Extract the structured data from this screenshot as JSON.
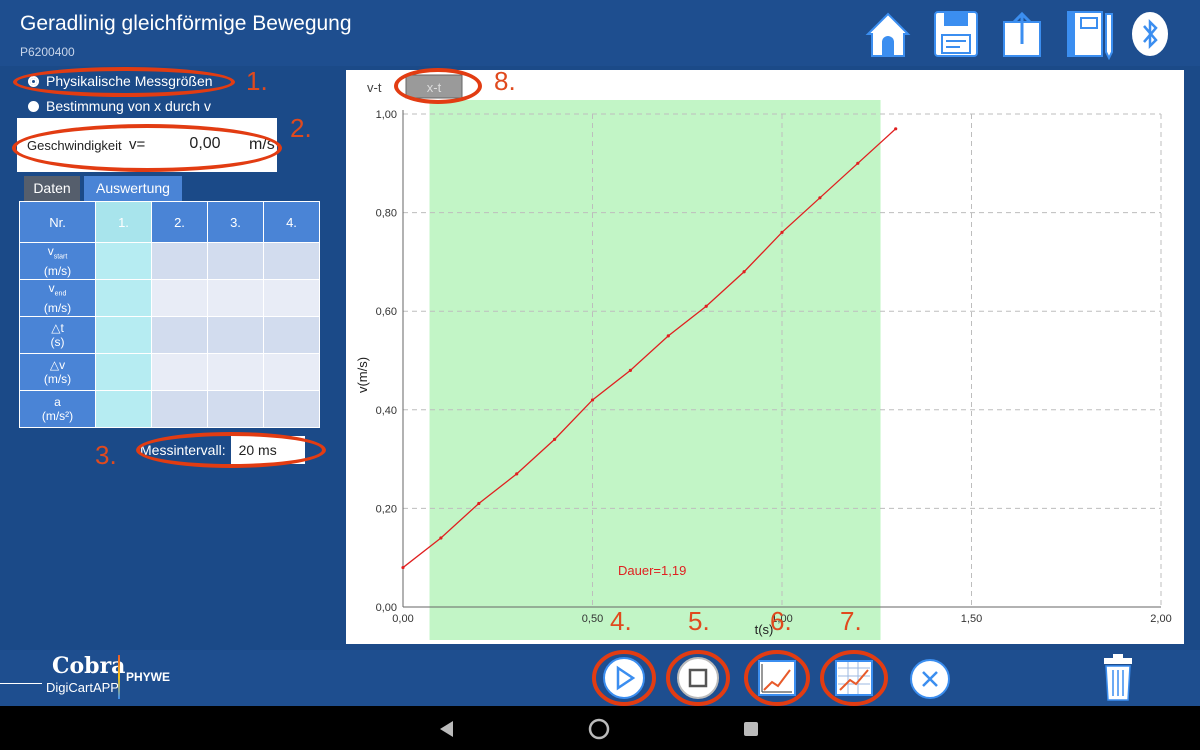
{
  "header": {
    "title": "Geradlinig gleichförmige Bewegung",
    "subtitle": "P6200400",
    "icons": [
      "home-icon",
      "save-icon",
      "export-icon",
      "notebook-icon",
      "bluetooth-icon"
    ]
  },
  "left": {
    "radio1": "Physikalische Messgrößen",
    "radio2": "Bestimmung von x durch v",
    "speed_label": "Geschwindigkeit",
    "speed_symbol": "v=",
    "speed_value": "0,00",
    "speed_unit": "m/s",
    "tab_data": "Daten",
    "tab_eval": "Auswertung",
    "table": {
      "header": [
        "Nr.",
        "1.",
        "2.",
        "3.",
        "4."
      ],
      "rows": [
        {
          "sym": "v",
          "sub": "start",
          "unit": "(m/s)"
        },
        {
          "sym": "v",
          "sub": "end",
          "unit": "(m/s)"
        },
        {
          "sym": "△t",
          "sub": "",
          "unit": "(s)"
        },
        {
          "sym": "△v",
          "sub": "",
          "unit": "(m/s)"
        },
        {
          "sym": "a",
          "sub": "",
          "unit": "(m/s²)"
        }
      ]
    },
    "interval_label": "Messintervall:",
    "interval_value": "20 ms"
  },
  "chart_tabs": {
    "vt": "v-t",
    "xt": "x-t"
  },
  "chart_data": {
    "type": "line",
    "xlabel": "t(s)",
    "ylabel": "v(m/s)",
    "xlim": [
      0,
      2
    ],
    "ylim": [
      0,
      1
    ],
    "xticks": [
      "0,00",
      "0,50",
      "1,00",
      "1,50",
      "2,00"
    ],
    "yticks": [
      "0,00",
      "0,20",
      "0,40",
      "0,60",
      "0,80",
      "1,00"
    ],
    "highlight_range": [
      0.07,
      1.26
    ],
    "annotation": "Dauer=1,19",
    "series": [
      {
        "color": "#e02020",
        "x": [
          0.0,
          0.1,
          0.2,
          0.3,
          0.4,
          0.5,
          0.6,
          0.7,
          0.8,
          0.9,
          1.0,
          1.1,
          1.2,
          1.3
        ],
        "y": [
          0.08,
          0.14,
          0.21,
          0.27,
          0.34,
          0.42,
          0.48,
          0.55,
          0.61,
          0.68,
          0.76,
          0.83,
          0.9,
          0.97
        ]
      }
    ]
  },
  "annotations": [
    "1.",
    "2.",
    "3.",
    "4.",
    "5.",
    "6.",
    "7.",
    "8."
  ],
  "footer": {
    "brand_cobra": "Cobra",
    "brand_phywe": "PHYWE",
    "brand_app": "DigiCartAPP"
  },
  "colors": {
    "accent": "#4a84d6",
    "highlight": "#c2f5c6",
    "annotation": "#e23c12"
  }
}
